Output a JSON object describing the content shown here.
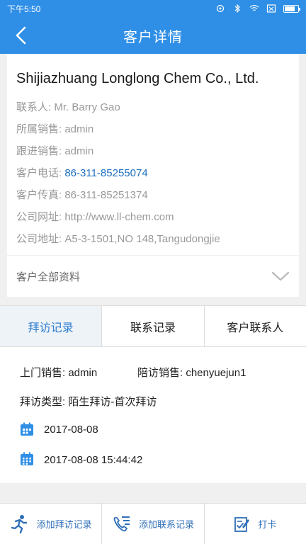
{
  "status_bar": {
    "time": "下午5:50"
  },
  "nav": {
    "title": "客户详情"
  },
  "company": {
    "name": "Shijiazhuang Longlong Chem Co., Ltd.",
    "fields": [
      {
        "label": "联系人:",
        "value": "Mr. Barry Gao"
      },
      {
        "label": "所属销售:",
        "value": "admin"
      },
      {
        "label": "跟进销售:",
        "value": "admin"
      },
      {
        "label": "客户电话:",
        "value": "86-311-85255074"
      },
      {
        "label": "客户传真:",
        "value": "86-311-85251374"
      },
      {
        "label": "公司网址:",
        "value": "http://www.ll-chem.com"
      },
      {
        "label": "公司地址:",
        "value": "A5-3-1501,NO 148,Tangudongjie"
      }
    ],
    "full_info_label": "客户全部资料"
  },
  "tabs": [
    {
      "label": "拜访记录",
      "active": true
    },
    {
      "label": "联系记录",
      "active": false
    },
    {
      "label": "客户联系人",
      "active": false
    }
  ],
  "record": {
    "visit_sales_label": "上门销售:",
    "visit_sales_value": "admin",
    "accompany_label": "陪访销售:",
    "accompany_value": "chenyuejun1",
    "type_label": "拜访类型:",
    "type_value": "陌生拜访-首次拜访",
    "date": "2017-08-08",
    "datetime": "2017-08-08 15:44:42"
  },
  "bottom_bar": {
    "add_visit": "添加拜访记录",
    "add_contact": "添加联系记录",
    "check_in": "打卡"
  },
  "colors": {
    "primary": "#2f8fe6",
    "link": "#1f6fc0",
    "bottom_text": "#2f6fb8"
  }
}
